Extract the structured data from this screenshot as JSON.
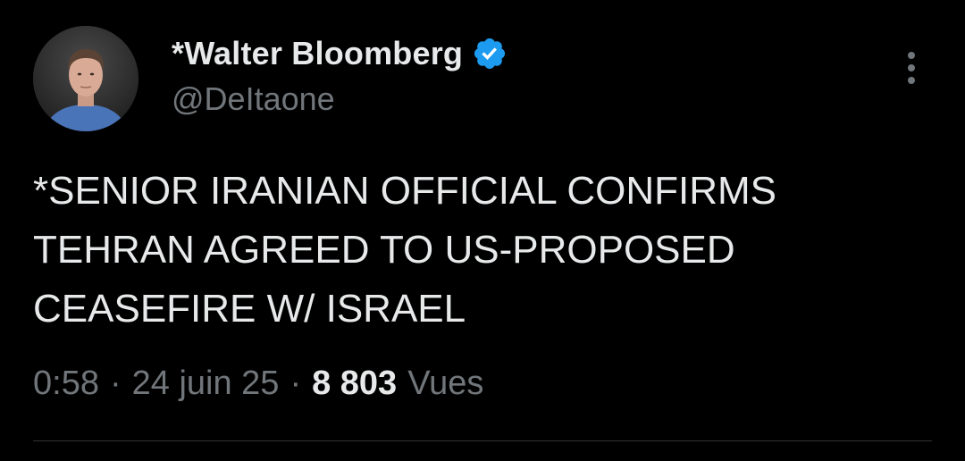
{
  "author": {
    "display_name": "*Walter Bloomberg",
    "handle": "@DeItaone",
    "verified": true,
    "avatar_icon": "profile-photo"
  },
  "tweet": {
    "text": "*SENIOR IRANIAN OFFICIAL CONFIRMS\nTEHRAN AGREED TO US-PROPOSED\nCEASEFIRE W/ ISRAEL"
  },
  "meta": {
    "time": "0:58",
    "separator": "·",
    "date": "24 juin 25",
    "views_count": "8 803",
    "views_label": "Vues"
  },
  "colors": {
    "background": "#000000",
    "primary_text": "#e7e9ea",
    "secondary_text": "#71767b",
    "verified_badge": "#1d9bf0",
    "divider": "#2f3336"
  },
  "icons": {
    "verified": "verified-badge-icon",
    "more": "more-vertical-icon"
  }
}
